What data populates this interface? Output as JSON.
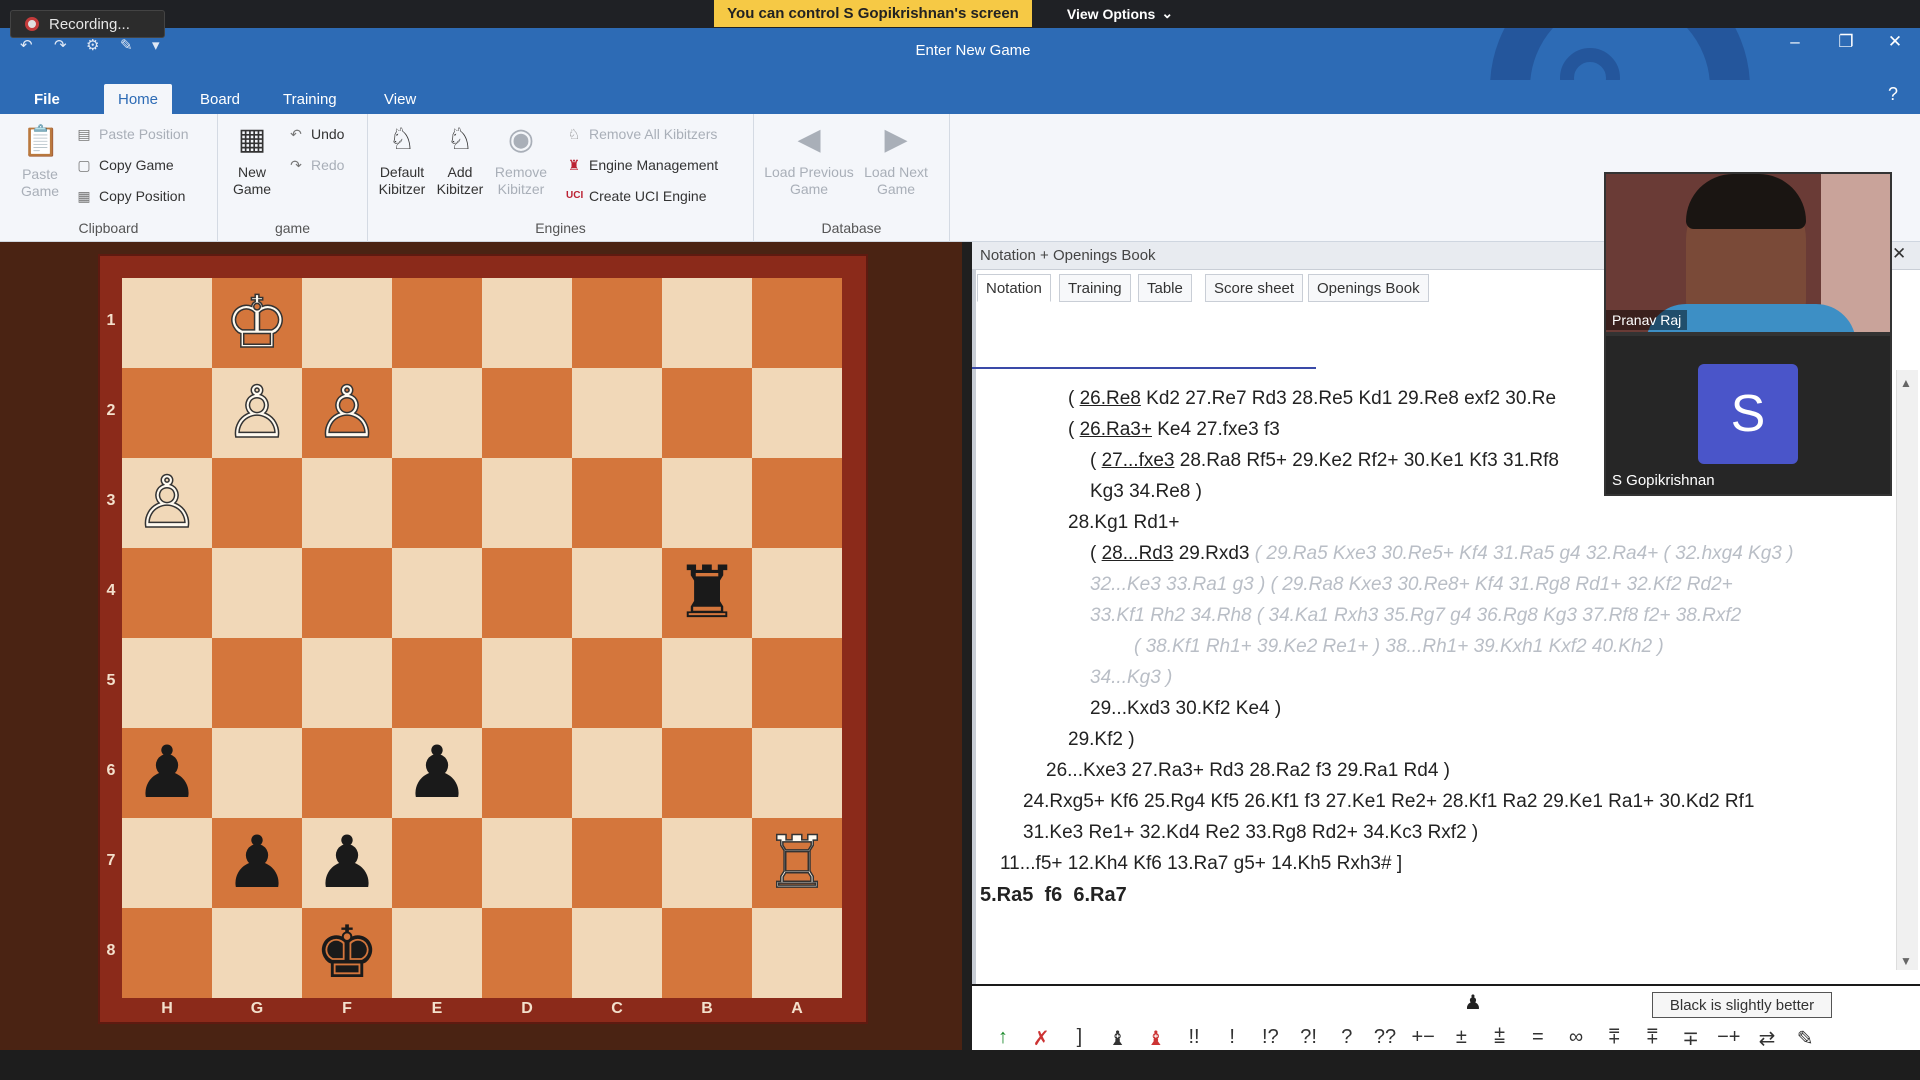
{
  "recording": {
    "label": "Recording..."
  },
  "share_banner": {
    "text": "You can control S Gopikrishnan's screen"
  },
  "view_options": {
    "label": "View Options"
  },
  "window": {
    "title": "Enter New Game"
  },
  "menu": {
    "tabs": [
      "File",
      "Home",
      "Board",
      "Training",
      "View"
    ],
    "active": "Home"
  },
  "ribbon": {
    "clipboard": {
      "label": "Clipboard",
      "paste_game": "Paste\nGame",
      "paste_position": "Paste Position",
      "copy_game": "Copy Game",
      "copy_position": "Copy Position"
    },
    "game": {
      "label": "game",
      "new_game": "New\nGame",
      "undo": "Undo",
      "redo": "Redo"
    },
    "engines": {
      "label": "Engines",
      "default_kibitzer": "Default\nKibitzer",
      "add_kibitzer": "Add\nKibitzer",
      "remove_kibitzer": "Remove\nKibitzer",
      "remove_all": "Remove All Kibitzers",
      "engine_mgmt": "Engine Management",
      "create_uci": "Create UCI Engine"
    },
    "database": {
      "label": "Database",
      "load_prev": "Load Previous\nGame",
      "load_next": "Load Next\nGame"
    }
  },
  "board": {
    "ranks": [
      "1",
      "2",
      "3",
      "4",
      "5",
      "6",
      "7",
      "8"
    ],
    "files": [
      "H",
      "G",
      "F",
      "E",
      "D",
      "C",
      "B",
      "A"
    ],
    "pieces": [
      {
        "sq": "g1",
        "glyph": "♔",
        "color": "white",
        "name": "white-king"
      },
      {
        "sq": "g2",
        "glyph": "♙",
        "color": "white",
        "name": "white-pawn"
      },
      {
        "sq": "f2",
        "glyph": "♙",
        "color": "white",
        "name": "white-pawn"
      },
      {
        "sq": "h3",
        "glyph": "♙",
        "color": "white",
        "name": "white-pawn"
      },
      {
        "sq": "b4",
        "glyph": "♜",
        "color": "black",
        "name": "black-rook"
      },
      {
        "sq": "h6",
        "glyph": "♟",
        "color": "black",
        "name": "black-pawn"
      },
      {
        "sq": "e6",
        "glyph": "♟",
        "color": "black",
        "name": "black-pawn"
      },
      {
        "sq": "g7",
        "glyph": "♟",
        "color": "black",
        "name": "black-pawn"
      },
      {
        "sq": "f7",
        "glyph": "♟",
        "color": "black",
        "name": "black-pawn"
      },
      {
        "sq": "a7",
        "glyph": "♖",
        "color": "white",
        "name": "white-rook"
      },
      {
        "sq": "f8",
        "glyph": "♚",
        "color": "black",
        "name": "black-king"
      }
    ]
  },
  "notation_pane": {
    "title": "Notation + Openings Book",
    "tabs": [
      "Notation",
      "Training",
      "Table",
      "Score sheet",
      "Openings Book"
    ],
    "active_tab": "Notation",
    "lines": {
      "l1a": "( ",
      "l1u": "26.Re8",
      "l1b": " Kd2 27.Re7 Rd3 28.Re5 Kd1 29.Re8 exf2 30.Re",
      "l2a": "( ",
      "l2u": "26.Ra3+",
      "l2b": " Ke4 27.fxe3 f3",
      "l3a": "( ",
      "l3u": "27...fxe3",
      "l3b": " 28.Ra8 Rf5+ 29.Ke2 Rf2+ 30.Ke1 Kf3 31.Rf8",
      "l4": "Kg3 34.Re8 )",
      "l5": "28.Kg1 Rd1+",
      "l6a": "( ",
      "l6u": "28...Rd3",
      "l6b": " 29.Rxd3 ",
      "l6g": "( 29.Ra5 Kxe3 30.Re5+ Kf4 31.Ra5 g4 32.Ra4+ ( 32.hxg4 Kg3 )",
      "l7g": "32...Ke3 33.Ra1 g3 ) ( 29.Ra8 Kxe3 30.Re8+ Kf4 31.Rg8 Rd1+ 32.Kf2 Rd2+",
      "l8g": "33.Kf1 Rh2 34.Rh8 ( 34.Ka1 Rxh3 35.Rg7 g4 36.Rg8 Kg3 37.Rf8 f2+ 38.Rxf2",
      "l9g": "( 38.Kf1 Rh1+ 39.Ke2 Re1+ ) 38...Rh1+ 39.Kxh1 Kxf2 40.Kh2 )",
      "l10g": "34...Kg3 )",
      "l11": "29...Kxd3 30.Kf2 Ke4 )",
      "l12": "29.Kf2 )",
      "l13": "26...Kxe3 27.Ra3+ Rd3 28.Ra2 f3 29.Ra1 Rd4 )",
      "l14": "24.Rxg5+ Kf6 25.Rg4 Kf5 26.Kf1 f3 27.Ke1 Re2+ 28.Kf1 Ra2 29.Ke1 Ra1+ 30.Kd2 Rf1",
      "l15": "31.Ke3 Re1+ 32.Kd4 Re2 33.Rg8 Rd2+ 34.Kc3 Rxf2 )",
      "l16": "11...f5+ 12.Kh4 Kf6 13.Ra7 g5+ 14.Kh5 Rxh3# ]",
      "l17": "5.Ra5  f6  6.Ra7"
    }
  },
  "annotation_bar": {
    "symbols": [
      "↑",
      "✗",
      "]",
      "♝",
      "♝",
      "!!",
      "!",
      "!?",
      "?!",
      "?",
      "??",
      "+−",
      "±",
      "⩲",
      "=",
      "∞",
      "⩱",
      "⩱",
      "∓",
      "−+",
      "⇄",
      "✎"
    ],
    "tooltip": "Black is slightly better",
    "side_glyph": "♟"
  },
  "video": {
    "p1_name": "Pranav Raj",
    "p2_name": "S Gopikrishnan",
    "p2_initial": "S",
    "avatar_color": "#4a55c9"
  }
}
